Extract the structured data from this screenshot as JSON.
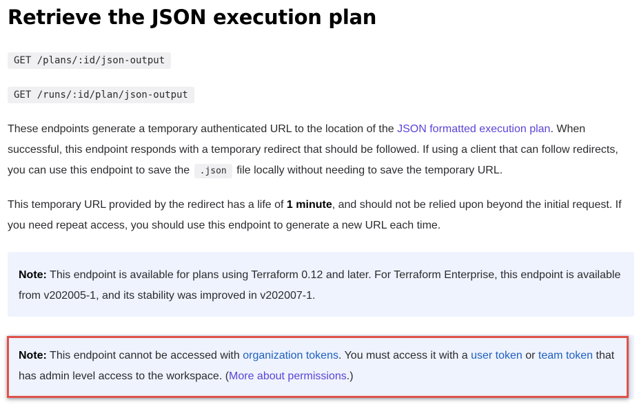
{
  "heading": "Retrieve the JSON execution plan",
  "endpoints": [
    "GET /plans/:id/json-output",
    "GET /runs/:id/plan/json-output"
  ],
  "para1": {
    "t1": "These endpoints generate a temporary authenticated URL to the location of the ",
    "link": "JSON formatted execution plan",
    "t2": ". When successful, this endpoint responds with a temporary redirect that should be followed. If using a client that can follow redirects, you can use this endpoint to save the ",
    "code": ".json",
    "t3": " file locally without needing to save the temporary URL."
  },
  "para2": {
    "t1": "This temporary URL provided by the redirect has a life of ",
    "bold": "1 minute",
    "t2": ", and should not be relied upon beyond the initial request. If you need repeat access, you should use this endpoint to generate a new URL each time."
  },
  "note1": {
    "label": "Note:",
    "text": " This endpoint is available for plans using Terraform 0.12 and later. For Terraform Enterprise, this endpoint is available from v202005-1, and its stability was improved in v202007-1."
  },
  "note2": {
    "label": "Note:",
    "t1": " This endpoint cannot be accessed with ",
    "link1": "organization tokens",
    "t2": ". You must access it with a ",
    "link2": "user token",
    "t3": " or ",
    "link3": "team token",
    "t4": " that has admin level access to the workspace. (",
    "link4": "More about permissions",
    "t5": ".)"
  },
  "colors": {
    "link_purple": "#5b44d6",
    "link_blue": "#1f5fbf",
    "note_bg": "#eef3fd",
    "highlight_border": "#e0514a"
  }
}
